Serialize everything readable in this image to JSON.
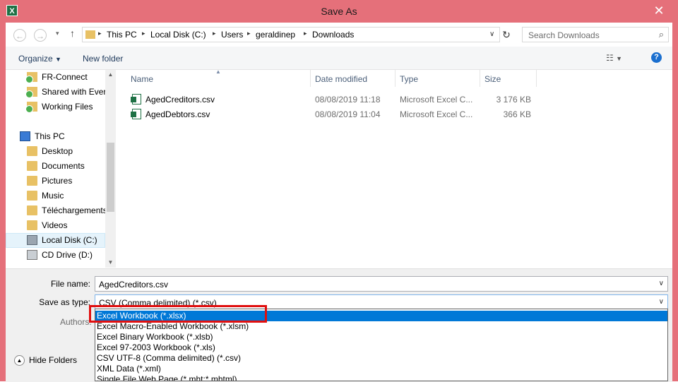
{
  "window": {
    "title": "Save As",
    "app_icon": "X",
    "close_glyph": "✕"
  },
  "nav_buttons": {
    "back": "←",
    "forward": "→",
    "up": "↑",
    "refresh": "↻"
  },
  "address": {
    "crumbs": [
      "This PC",
      "Local Disk (C:)",
      "Users",
      "geraldinep",
      "Downloads"
    ],
    "search_placeholder": "Search Downloads"
  },
  "toolbar": {
    "organize": "Organize",
    "new_folder": "New folder",
    "help": "?"
  },
  "sidebar": {
    "items": [
      {
        "label": "FR-Connect",
        "icon": "sync-folder-icon"
      },
      {
        "label": "Shared with Everyone",
        "icon": "sync-folder-icon"
      },
      {
        "label": "Working Files",
        "icon": "sync-folder-icon"
      },
      {
        "label": "This PC",
        "icon": "computer-icon"
      },
      {
        "label": "Desktop",
        "icon": "folder-icon"
      },
      {
        "label": "Documents",
        "icon": "folder-icon"
      },
      {
        "label": "Pictures",
        "icon": "folder-icon"
      },
      {
        "label": "Music",
        "icon": "folder-icon"
      },
      {
        "label": "Téléchargements",
        "icon": "folder-icon"
      },
      {
        "label": "Videos",
        "icon": "folder-icon"
      },
      {
        "label": "Local Disk (C:)",
        "icon": "drive-icon"
      },
      {
        "label": "CD Drive (D:)",
        "icon": "cd-drive-icon"
      }
    ]
  },
  "columns": {
    "name": "Name",
    "date": "Date modified",
    "type": "Type",
    "size": "Size"
  },
  "files": [
    {
      "name": "AgedCreditors.csv",
      "date": "08/08/2019 11:18",
      "type": "Microsoft Excel C...",
      "size": "3 176 KB"
    },
    {
      "name": "AgedDebtors.csv",
      "date": "08/08/2019 11:04",
      "type": "Microsoft Excel C...",
      "size": "366 KB"
    }
  ],
  "form": {
    "file_name_label": "File name:",
    "file_name_value": "AgedCreditors.csv",
    "save_type_label": "Save as type:",
    "save_type_value": "CSV (Comma delimited) (*.csv)",
    "authors_label": "Authors:",
    "hide_folders": "Hide Folders"
  },
  "type_options": [
    "Excel Workbook (*.xlsx)",
    "Excel Macro-Enabled Workbook (*.xlsm)",
    "Excel Binary Workbook (*.xlsb)",
    "Excel 97-2003 Workbook (*.xls)",
    "CSV UTF-8 (Comma delimited) (*.csv)",
    "XML Data (*.xml)",
    "Single File Web Page (*.mht;*.mhtml)"
  ],
  "colors": {
    "title_bar": "#e5707a",
    "selection": "#0078d7",
    "highlight_box": "#e01010"
  }
}
